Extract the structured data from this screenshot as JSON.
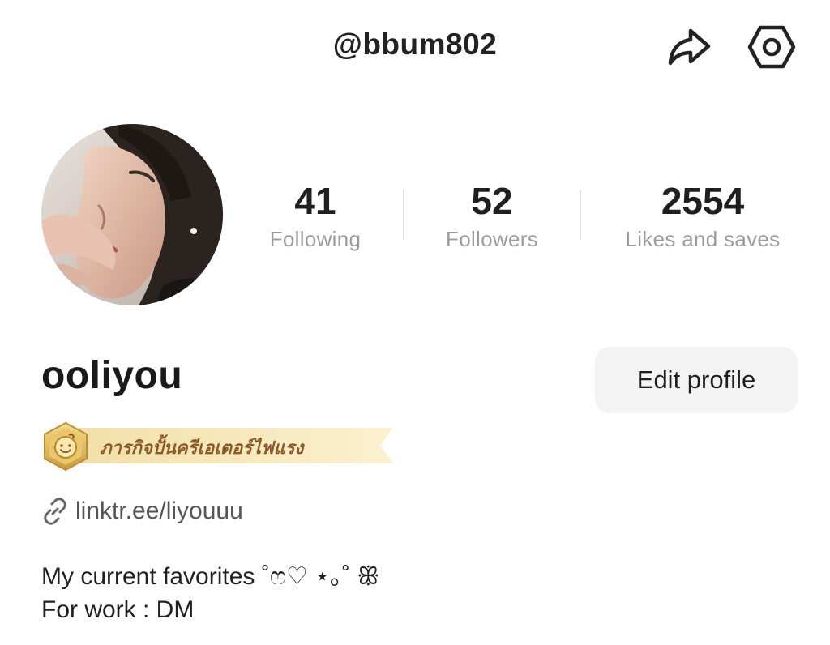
{
  "header": {
    "handle": "@bbum802",
    "share_icon": "share-icon",
    "settings_icon": "settings-hexagon-icon"
  },
  "stats": {
    "following": {
      "value": "41",
      "label": "Following"
    },
    "followers": {
      "value": "52",
      "label": "Followers"
    },
    "likes": {
      "value": "2554",
      "label": "Likes and saves"
    }
  },
  "profile": {
    "name": "ooliyou",
    "edit_label": "Edit profile",
    "badge_text": "ภารกิจปั้นครีเอเตอร์ไฟแรง",
    "link": "linktr.ee/liyouuu",
    "bio_line1": "My current favorites ˚ෆ♡ ⋆｡˚ ꕥ",
    "bio_line2": "For work : DM"
  },
  "colors": {
    "text": "#1f1f1f",
    "muted": "#9c9c9c",
    "badge_gold": "#e7cf8f",
    "badge_text": "#8a5a2b",
    "button_bg": "#f3f3f3"
  }
}
